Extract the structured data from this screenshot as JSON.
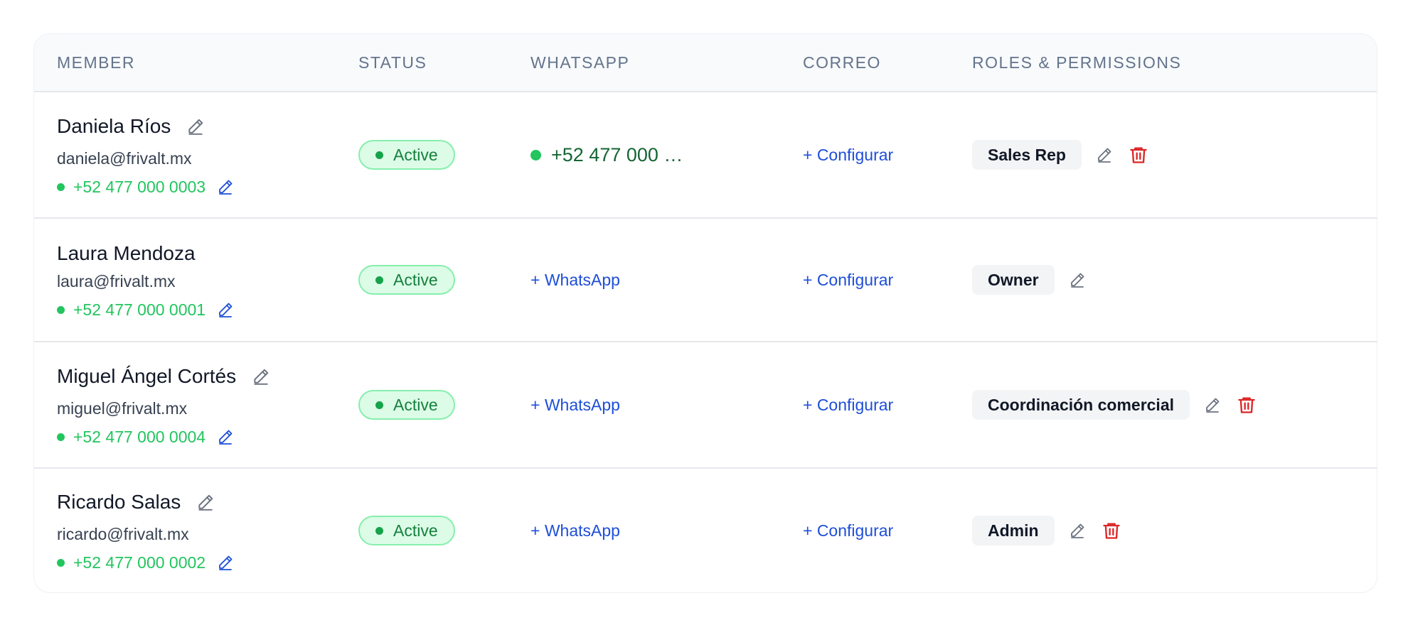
{
  "headers": {
    "member": "MEMBER",
    "status": "STATUS",
    "whatsapp": "WHATSAPP",
    "correo": "CORREO",
    "roles": "ROLES & PERMISSIONS"
  },
  "rows": [
    {
      "name": "Daniela Ríos",
      "email": "daniela@frivalt.mx",
      "phone": "+52 477 000 0003",
      "status": "Active",
      "whatsapp_number": "+52 477 000 …",
      "whatsapp_add": "",
      "correo": "+ Configurar",
      "role": "Sales Rep"
    },
    {
      "name": "Laura Mendoza",
      "email": "laura@frivalt.mx",
      "phone": "+52 477 000 0001",
      "status": "Active",
      "whatsapp_number": "",
      "whatsapp_add": "+ WhatsApp",
      "correo": "+ Configurar",
      "role": "Owner"
    },
    {
      "name": "Miguel Ángel Cortés",
      "email": "miguel@frivalt.mx",
      "phone": "+52 477 000 0004",
      "status": "Active",
      "whatsapp_number": "",
      "whatsapp_add": "+ WhatsApp",
      "correo": "+ Configurar",
      "role": "Coordinación comercial"
    },
    {
      "name": "Ricardo Salas",
      "email": "ricardo@frivalt.mx",
      "phone": "+52 477 000 0002",
      "status": "Active",
      "whatsapp_number": "",
      "whatsapp_add": "+ WhatsApp",
      "correo": "+ Configurar",
      "role": "Admin"
    }
  ],
  "icons": {
    "edit": "pencil-icon",
    "delete": "trash-icon",
    "online": "status-dot-icon"
  },
  "colors": {
    "active_bg": "#dcfce7",
    "active_text": "#15803d",
    "online": "#22c55e",
    "link": "#1d4ed8",
    "delete": "#dc2626"
  }
}
